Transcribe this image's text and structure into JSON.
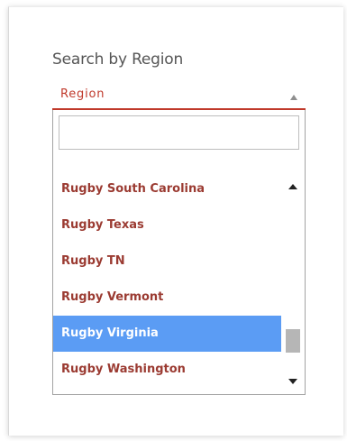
{
  "filter": {
    "label": "Search by Region",
    "select_value": "Region",
    "search_input_value": ""
  },
  "options": [
    {
      "label": "Rugby South Carolina",
      "selected": false
    },
    {
      "label": "Rugby Texas",
      "selected": false
    },
    {
      "label": "Rugby TN",
      "selected": false
    },
    {
      "label": "Rugby Vermont",
      "selected": false
    },
    {
      "label": "Rugby Virginia",
      "selected": true
    },
    {
      "label": "Rugby Washington",
      "selected": false
    }
  ],
  "scroll": {
    "position_fraction": 0.88
  },
  "colors": {
    "accent": "#c0392b",
    "option_text": "#9b3b32",
    "selected_bg": "#5b9cf4",
    "selected_text": "#ffffff"
  },
  "icons": {
    "select_caret": "caret-up-icon",
    "scroll_up": "scroll-up-arrow-icon",
    "scroll_down": "scroll-down-arrow-icon"
  }
}
